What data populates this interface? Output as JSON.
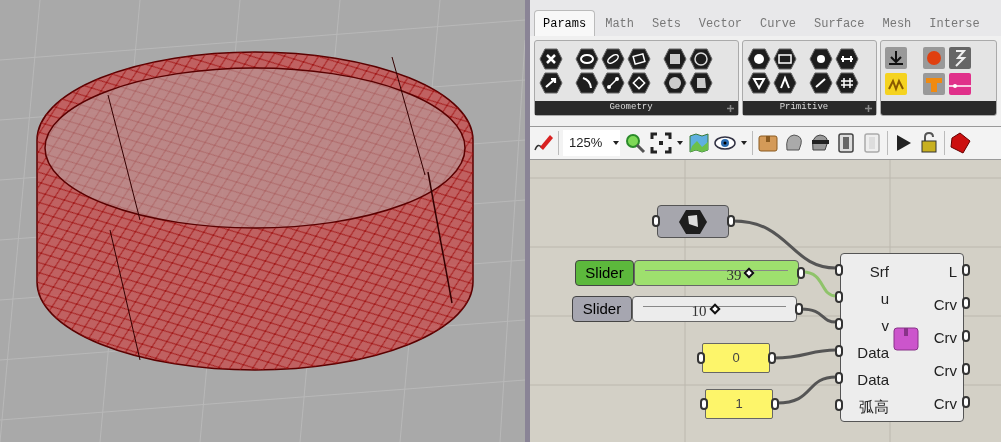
{
  "tabs": [
    {
      "label": "Params",
      "selected": true
    },
    {
      "label": "Math",
      "selected": false
    },
    {
      "label": "Sets",
      "selected": false
    },
    {
      "label": "Vector",
      "selected": false
    },
    {
      "label": "Curve",
      "selected": false
    },
    {
      "label": "Surface",
      "selected": false
    },
    {
      "label": "Mesh",
      "selected": false
    },
    {
      "label": "Interse",
      "selected": false
    }
  ],
  "ribbon": {
    "groups": [
      {
        "label": "Geometry"
      },
      {
        "label": "Primitive"
      }
    ]
  },
  "canvas_toolbar": {
    "zoom": "125%"
  },
  "canvas": {
    "sliders": [
      {
        "label": "Slider",
        "value": "39",
        "level": 0.73,
        "selected": true
      },
      {
        "label": "Slider",
        "value": "10",
        "level": 0.5,
        "selected": false
      }
    ],
    "panels": [
      {
        "text": "0"
      },
      {
        "text": "1"
      }
    ],
    "component": {
      "inputs": [
        "Srf",
        "u",
        "v",
        "Data",
        "Data",
        "弧高"
      ],
      "outputs": [
        "L",
        "Crv",
        "Crv",
        "Crv",
        "Crv"
      ]
    }
  }
}
